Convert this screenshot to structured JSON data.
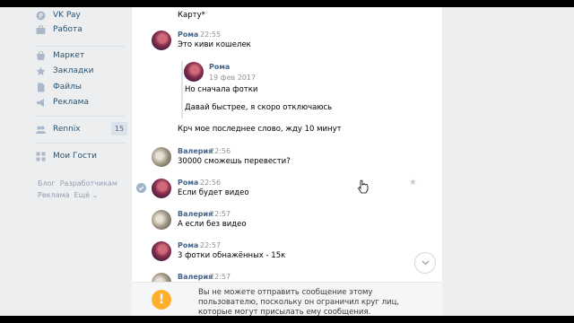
{
  "sidebar": {
    "items": [
      {
        "label": "VK Pay",
        "icon": "vk-pay-icon"
      },
      {
        "label": "Работа",
        "icon": "briefcase-icon"
      },
      {
        "label": "Маркет",
        "icon": "market-icon"
      },
      {
        "label": "Закладки",
        "icon": "star-icon"
      },
      {
        "label": "Файлы",
        "icon": "file-icon"
      },
      {
        "label": "Реклама",
        "icon": "ads-icon"
      },
      {
        "label": "Rennix",
        "icon": "community-icon",
        "badge": "15"
      },
      {
        "label": "Мои Гости",
        "icon": "apps-icon"
      }
    ],
    "footer": [
      "Блог",
      "Разработчикам",
      "Реклама",
      "Ещё ⌄"
    ]
  },
  "chat": {
    "partial_text": "Карту*",
    "messages": [
      {
        "author": "Рома",
        "time": "22:55",
        "text": "Это киви кошелек",
        "quote": {
          "author": "Рома",
          "date": "19 фев 2017",
          "lines": [
            "Но сначала фотки",
            "Давай быстрее, я скоро отключаюсь"
          ]
        },
        "after": "Крч мое последнее слово, жду 10 минут"
      },
      {
        "author": "Валерия",
        "time": "22:56",
        "text": "30000 сможешь перевести?"
      },
      {
        "author": "Рома",
        "time": "22:56",
        "text": "Если будет видео"
      },
      {
        "author": "Валерия",
        "time": "22:57",
        "text": "А если без видео"
      },
      {
        "author": "Рома",
        "time": "22:57",
        "text": "3 фотки обнажённых - 15к"
      },
      {
        "author": "Валерия",
        "time": "22:57",
        "text": ""
      }
    ],
    "notice": "Вы не можете отправить сообщение этому пользователю, поскольку он ограничил круг лиц, которые могут присылать ему сообщения."
  },
  "colors": {
    "link": "#42648b",
    "sidebar_bg": "#edeef0",
    "warning": "#ffaf2b"
  }
}
